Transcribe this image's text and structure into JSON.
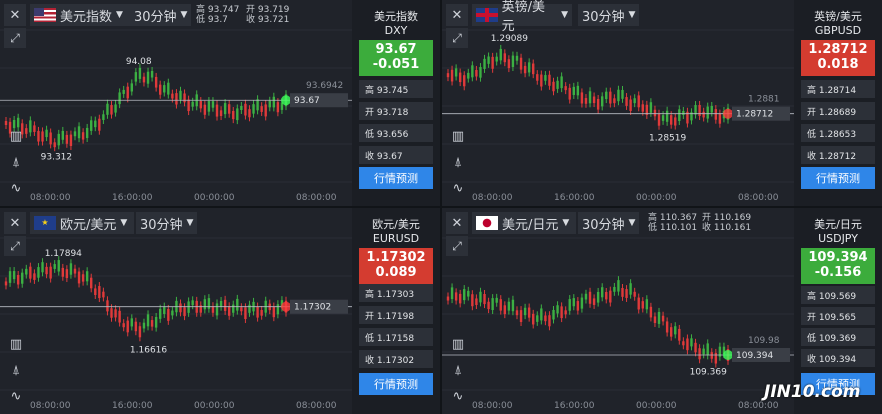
{
  "panels": [
    {
      "pair": "美元指数",
      "timeframe": "30分钟",
      "ohlc": {
        "high": "高 93.747",
        "low": "低 93.7",
        "open": "开 93.719",
        "close": "收 93.721"
      },
      "title": "美元指数",
      "code": "DXY",
      "price": "93.67",
      "change": "-0.051",
      "quote_color": "#3cac3c",
      "rows": [
        "高 93.745",
        "开 93.718",
        "低 93.656",
        "收 93.67"
      ],
      "predict": "行情预测",
      "xaxis": [
        "08:00:00",
        "16:00:00",
        "00:00:00",
        "08:00:00"
      ],
      "annot_high": "94.08",
      "annot_low": "93.312",
      "axis_tag": "93.67",
      "axis_tag2": "93.6942",
      "chart_data": {
        "type": "candlestick",
        "hint": "trend down then up then flat"
      }
    },
    {
      "pair": "英镑/美元",
      "timeframe": "30分钟",
      "ohlc": {
        "high": "",
        "low": "",
        "open": "",
        "close": ""
      },
      "title": "英镑/美元",
      "code": "GBPUSD",
      "price": "1.28712",
      "change": "0.018",
      "quote_color": "#d43c30",
      "rows": [
        "高 1.28714",
        "开 1.28689",
        "低 1.28653",
        "收 1.28712"
      ],
      "predict": "行情预测",
      "xaxis": [
        "08:00:00",
        "16:00:00",
        "00:00:00",
        "08:00:00"
      ],
      "annot_high": "1.29089",
      "annot_low": "1.28519",
      "axis_tag": "1.28712",
      "axis_tag2": "1.2881"
    },
    {
      "pair": "欧元/美元",
      "timeframe": "30分钟",
      "ohlc": {
        "high": "",
        "low": "",
        "open": "",
        "close": ""
      },
      "title": "欧元/美元",
      "code": "EURUSD",
      "price": "1.17302",
      "change": "0.089",
      "quote_color": "#d43c30",
      "rows": [
        "高 1.17303",
        "开 1.17198",
        "低 1.17158",
        "收 1.17302"
      ],
      "predict": "行情预测",
      "xaxis": [
        "08:00:00",
        "16:00:00",
        "00:00:00",
        "08:00:00"
      ],
      "annot_high": "1.17894",
      "annot_low": "1.16616",
      "axis_tag": "1.17302",
      "axis_tag2": ""
    },
    {
      "pair": "美元/日元",
      "timeframe": "30分钟",
      "ohlc": {
        "high": "高 110.367",
        "low": "低 110.101",
        "open": "开 110.169",
        "close": "收 110.161"
      },
      "title": "美元/日元",
      "code": "USDJPY",
      "price": "109.394",
      "change": "-0.156",
      "quote_color": "#3cac3c",
      "rows": [
        "高 109.569",
        "开 109.565",
        "低 109.369",
        "收 109.394"
      ],
      "predict": "行情预测",
      "xaxis": [
        "08:00:00",
        "16:00:00",
        "00:00:00",
        "08:00:00"
      ],
      "annot_high": "",
      "annot_low": "109.369",
      "axis_tag": "109.394",
      "axis_tag2": "109.98"
    }
  ],
  "watermark": "JIN10.com",
  "icons": {
    "close": "close-icon",
    "expand": "expand-icon",
    "dropdown": "chevron-down-icon",
    "tools": [
      "bar-chart-icon",
      "drawing-icon",
      "indicator-icon"
    ]
  }
}
